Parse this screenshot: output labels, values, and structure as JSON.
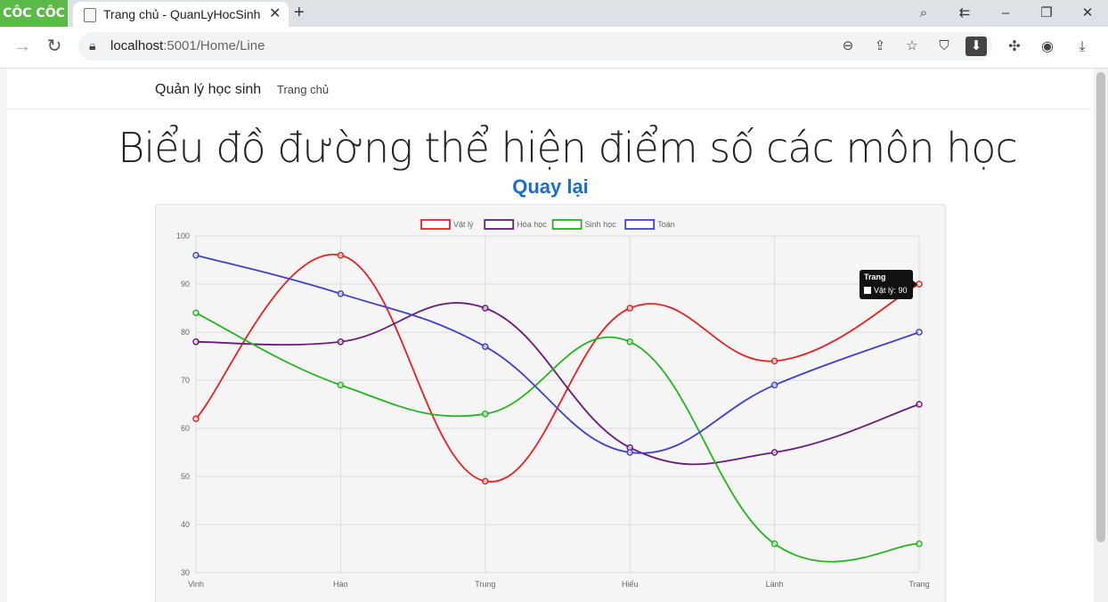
{
  "browser": {
    "brand": "CÔC CÔC",
    "tab_title": "Trang chủ - QuanLyHocSinh",
    "url_host": "localhost",
    "url_rest": ":5001/Home/Line"
  },
  "navbar": {
    "brand": "Quản lý học sinh",
    "link": "Trang chủ"
  },
  "page": {
    "title": "Biểu đồ đường thể hiện điểm số các môn học",
    "back_link": "Quay lại"
  },
  "chart_data": {
    "type": "line",
    "categories": [
      "Vinh",
      "Hào",
      "Trung",
      "Hiếu",
      "Lành",
      "Trang"
    ],
    "ylim": [
      30,
      100
    ],
    "yticks": [
      30,
      40,
      50,
      60,
      70,
      80,
      90,
      100
    ],
    "grid": true,
    "legend": "top",
    "series": [
      {
        "name": "Vật lý",
        "color": "#e52222",
        "values": [
          62,
          96,
          49,
          85,
          74,
          90
        ]
      },
      {
        "name": "Hóa học",
        "color": "#6a1a7a",
        "values": [
          78,
          78,
          85,
          56,
          55,
          65
        ]
      },
      {
        "name": "Sinh học",
        "color": "#22b51d",
        "values": [
          84,
          69,
          63,
          78,
          36,
          36
        ]
      },
      {
        "name": "Toán",
        "color": "#4040cc",
        "values": [
          96,
          88,
          77,
          55,
          69,
          80
        ]
      }
    ],
    "tooltip": {
      "title": "Trang",
      "label": "Vật lý: 90"
    }
  }
}
